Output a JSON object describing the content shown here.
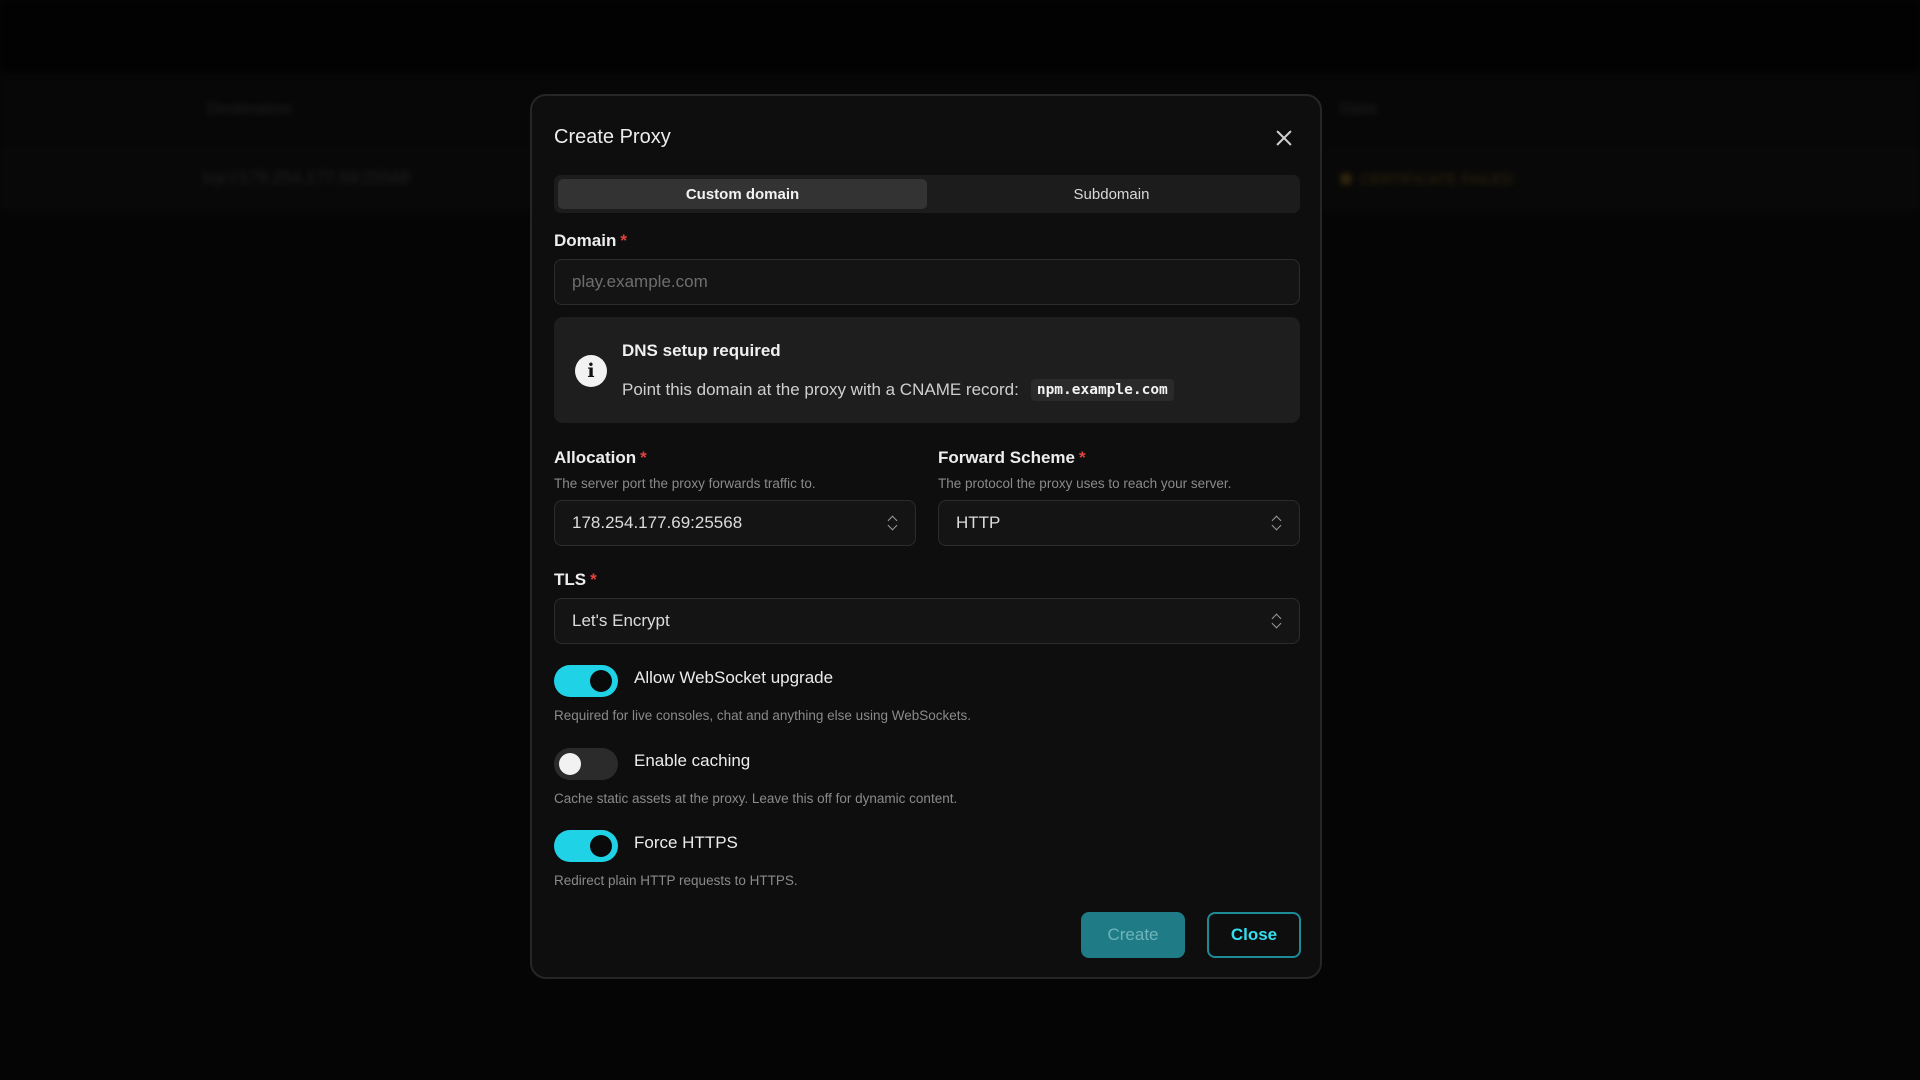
{
  "background": {
    "column_destination": "Destination",
    "column_state": "State",
    "row_destination": "tcp://178.254.177.69:25568",
    "row_state": "CERTIFICATE FAILED"
  },
  "modal": {
    "title": "Create Proxy",
    "tabs": [
      {
        "label": "Custom domain",
        "active": true
      },
      {
        "label": "Subdomain",
        "active": false
      }
    ],
    "domain": {
      "label": "Domain",
      "required_mark": "*",
      "placeholder": "play.example.com",
      "value": ""
    },
    "dns_alert": {
      "icon": "info-icon",
      "title": "DNS setup required",
      "text": "Point this domain at the proxy with a CNAME record:",
      "cname": "npm.example.com"
    },
    "allocation": {
      "label": "Allocation",
      "required_mark": "*",
      "hint": "The server port the proxy forwards traffic to.",
      "value": "178.254.177.69:25568"
    },
    "forward_scheme": {
      "label": "Forward Scheme",
      "required_mark": "*",
      "hint": "The protocol the proxy uses to reach your server.",
      "value": "HTTP"
    },
    "tls": {
      "label": "TLS",
      "required_mark": "*",
      "value": "Let's Encrypt"
    },
    "toggles": [
      {
        "label": "Allow WebSocket upgrade",
        "hint": "Required for live consoles, chat and anything else using WebSockets.",
        "on": true
      },
      {
        "label": "Enable caching",
        "hint": "Cache static assets at the proxy. Leave this off for dynamic content.",
        "on": false
      },
      {
        "label": "Force HTTPS",
        "hint": "Redirect plain HTTP requests to HTTPS.",
        "on": true
      }
    ],
    "buttons": {
      "create": "Create",
      "close": "Close"
    }
  },
  "colors": {
    "accent": "#1fd2e6",
    "required": "#e0443e",
    "modal_bg": "#0e0e0e"
  }
}
